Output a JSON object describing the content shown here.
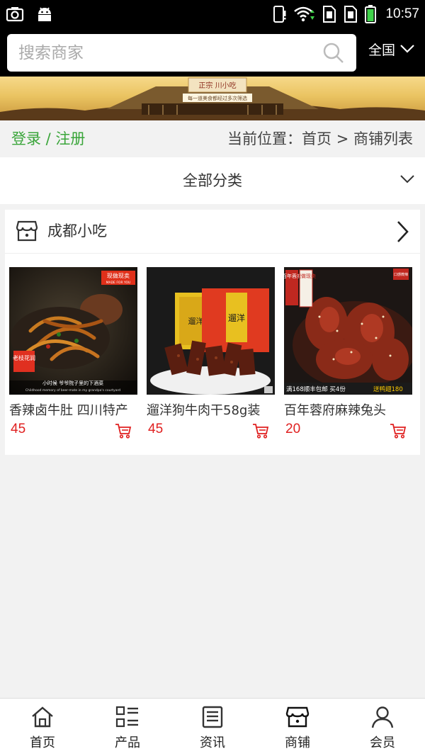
{
  "status_bar": {
    "time": "10:57",
    "left_icons": [
      "screenshot-icon",
      "android-icon"
    ],
    "right_icons": [
      "phone-alert-icon",
      "wifi-icon",
      "sim1-icon",
      "sim2-icon",
      "battery-icon"
    ]
  },
  "search": {
    "placeholder": "搜索商家",
    "region": "全国"
  },
  "banner": {
    "sign_main": "正宗 川小吃",
    "sign_sub": "每一道美食都经过多次筛选"
  },
  "breadcrumb": {
    "login": "登录 / 注册",
    "location": "当前位置：首页 > 商铺列表"
  },
  "category": {
    "label": "全部分类"
  },
  "shop": {
    "name": "成都小吃",
    "products": [
      {
        "name": "香辣卤牛肚 四川特产",
        "price": "45",
        "img_tag": "现做现卖",
        "img_tag_sub": "MADE FOR YOU",
        "img_seal": "老枝花润",
        "img_caption": "小时候  爷爷院子里的下酒菜",
        "img_caption_en": "Childhood memory of beer-mate in my grandpa's courtyard"
      },
      {
        "name": "遛洋狗牛肉干58g装",
        "price": "45",
        "img_pack_left": "遛洋狗",
        "img_pack_right": "遛洋"
      },
      {
        "name": "百年蓉府麻辣兔头",
        "price": "20",
        "img_seal": "百年蓉府",
        "img_tag": "现做现卖",
        "img_corner": "口感微辣",
        "img_promo_a": "满168顺丰包邮  买4份",
        "img_promo_b": "送鸭翅180"
      }
    ]
  },
  "bottom_nav": [
    {
      "label": "首页",
      "icon": "home-icon"
    },
    {
      "label": "产品",
      "icon": "grid-list-icon"
    },
    {
      "label": "资讯",
      "icon": "news-icon"
    },
    {
      "label": "商铺",
      "icon": "store-icon"
    },
    {
      "label": "会员",
      "icon": "user-icon"
    }
  ],
  "colors": {
    "accent_green": "#3aa53a",
    "price_red": "#e02020",
    "header_bg": "#000000"
  }
}
